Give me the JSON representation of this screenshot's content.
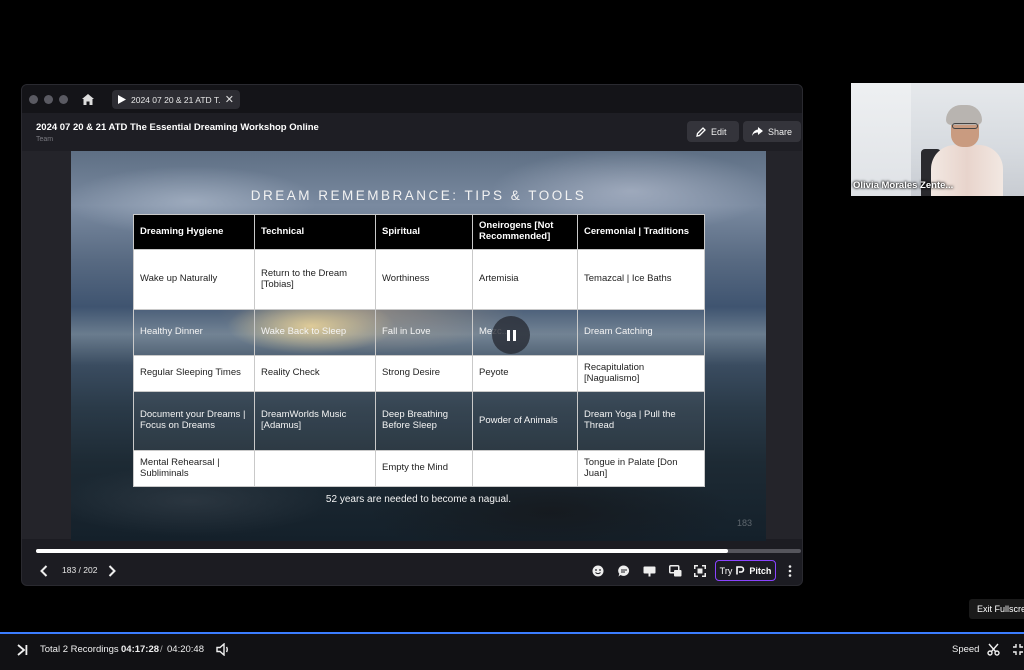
{
  "pitch_window": {
    "tab_title": "2024 07 20 & 21 ATD T...",
    "doc_title": "2024 07 20 & 21 ATD The Essential Dreaming Workshop Online",
    "doc_subtitle": "Team",
    "edit_label": "Edit",
    "share_label": "Share"
  },
  "slide": {
    "title": "DREAM REMEMBRANCE: TIPS & TOOLS",
    "footnote": "52 years are needed to become a nagual.",
    "slide_number_watermark": "183",
    "table": {
      "headers": [
        "Dreaming Hygiene",
        "Technical",
        "Spiritual",
        "Oneirogens [Not Recommended]",
        "Ceremonial | Traditions"
      ],
      "rows": [
        [
          "Wake up Naturally",
          "Return to the Dream [Tobias]",
          "Worthiness",
          "Artemisia",
          "Temazcal | Ice Baths"
        ],
        [
          "Healthy Dinner",
          "Wake Back to Sleep",
          "Fall in Love",
          "Mezc...",
          "Dream Catching"
        ],
        [
          "Regular Sleeping Times",
          "Reality Check",
          "Strong Desire",
          "Peyote",
          "Recapitulation [Nagualismo]"
        ],
        [
          "Document your Dreams | Focus on Dreams",
          "DreamWorlds Music [Adamus]",
          "Deep Breathing Before Sleep",
          "Powder of Animals",
          "Dream Yoga | Pull the Thread"
        ],
        [
          "Mental Rehearsal | Subliminals",
          "",
          "Empty the Mind",
          "",
          "Tongue in Palate [Don Juan]"
        ]
      ]
    }
  },
  "player": {
    "slide_counter": "183 / 202",
    "progress_fraction": 0.905,
    "try_label": "Try",
    "pitch_label": "Pitch"
  },
  "participant": {
    "name": "Olivia Morales Zente..."
  },
  "tooltip": {
    "exit_fullscreen": "Exit Fullscre"
  },
  "recording_bar": {
    "total_recordings": "Total 2 Recordings",
    "current_time": "04:17:28",
    "separator": "/",
    "total_time": "04:20:48",
    "speed_label": "Speed"
  }
}
